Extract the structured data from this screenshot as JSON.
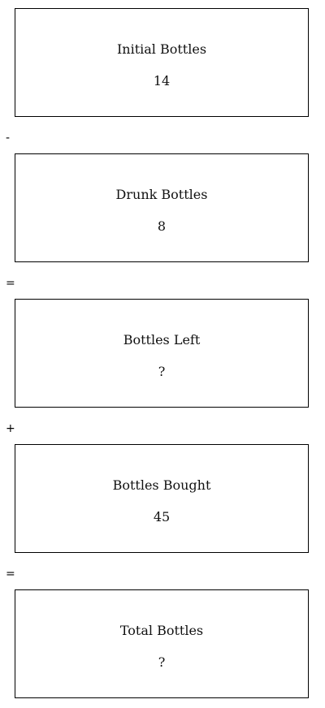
{
  "steps": [
    {
      "label": "Initial Bottles",
      "value": "14"
    },
    {
      "label": "Drunk Bottles",
      "value": "8"
    },
    {
      "label": "Bottles Left",
      "value": "?"
    },
    {
      "label": "Bottles Bought",
      "value": "45"
    },
    {
      "label": "Total Bottles",
      "value": "?"
    }
  ],
  "operators": [
    "-",
    "=",
    "+",
    "="
  ]
}
